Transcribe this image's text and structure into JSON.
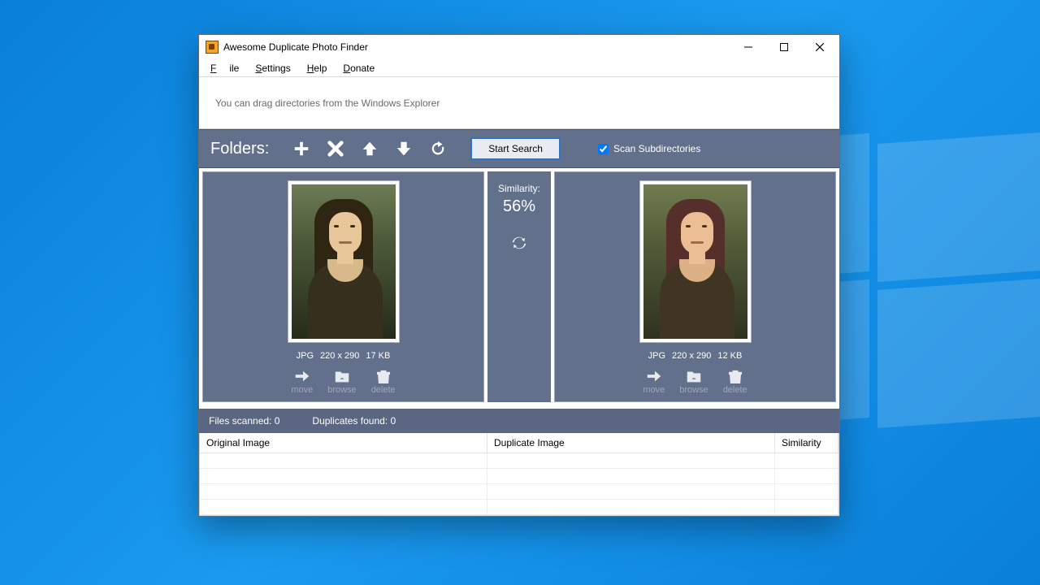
{
  "window": {
    "title": "Awesome Duplicate Photo Finder"
  },
  "menu": {
    "file": "File",
    "settings": "Settings",
    "help": "Help",
    "donate": "Donate"
  },
  "drag_hint": "You can drag directories from the Windows Explorer",
  "toolbar": {
    "label": "Folders:",
    "start": "Start Search",
    "scan_sub": "Scan Subdirectories"
  },
  "similarity": {
    "label": "Similarity:",
    "value": "56%"
  },
  "left": {
    "format": "JPG",
    "dims": "220 x 290",
    "size": "17 KB"
  },
  "right": {
    "format": "JPG",
    "dims": "220 x 290",
    "size": "12 KB"
  },
  "actions": {
    "move": "move",
    "browse": "browse",
    "delete": "delete"
  },
  "status": {
    "scanned_label": "Files scanned:",
    "scanned_value": "0",
    "dups_label": "Duplicates found:",
    "dups_value": "0"
  },
  "columns": {
    "c1": "Original Image",
    "c2": "Duplicate Image",
    "c3": "Similarity"
  }
}
